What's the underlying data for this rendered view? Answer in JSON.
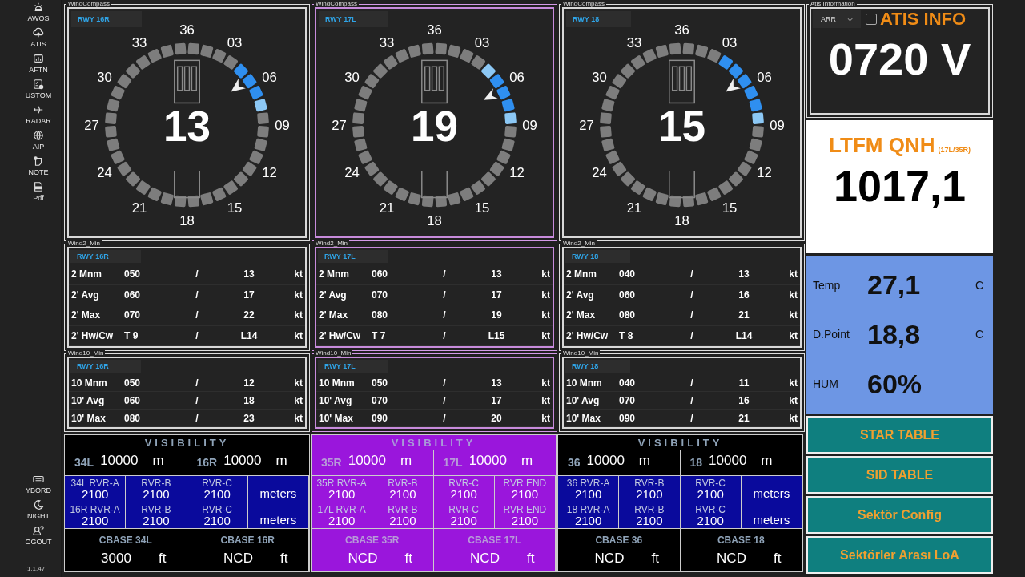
{
  "sidebar": {
    "top_items": [
      {
        "label": "AWOS"
      },
      {
        "label": "ATIS"
      },
      {
        "label": "AFTN"
      },
      {
        "label": "USTOM"
      },
      {
        "label": "RADAR"
      },
      {
        "label": "AIP"
      },
      {
        "label": "NOTE"
      },
      {
        "label": "Pdf"
      }
    ],
    "bottom_items": [
      {
        "label": "YBORD"
      },
      {
        "label": "NIGHT"
      },
      {
        "label": "OGOUT"
      }
    ],
    "version": "1.1.47"
  },
  "columns": [
    {
      "selected": false,
      "compass": {
        "legend": "WindCompass",
        "runway_tab": "RWY 16R",
        "runway_heading": "13",
        "dial_labels": [
          "36",
          "03",
          "06",
          "09",
          "12",
          "15",
          "18",
          "21",
          "24",
          "27",
          "30",
          "33"
        ],
        "segments": [
          {
            "kind": "off"
          },
          {
            "kind": "off"
          },
          {
            "kind": "off"
          },
          {
            "kind": "off"
          },
          {
            "kind": "main"
          },
          {
            "kind": "main"
          },
          {
            "kind": "main"
          },
          {
            "kind": "edge"
          },
          {
            "kind": "off"
          },
          {
            "kind": "off"
          },
          {
            "kind": "off"
          },
          {
            "kind": "off"
          },
          {
            "kind": "off"
          },
          {
            "kind": "off"
          },
          {
            "kind": "off"
          },
          {
            "kind": "off"
          },
          {
            "kind": "off"
          },
          {
            "kind": "off"
          },
          {
            "kind": "off"
          },
          {
            "kind": "off"
          },
          {
            "kind": "off"
          },
          {
            "kind": "off"
          },
          {
            "kind": "off"
          },
          {
            "kind": "off"
          },
          {
            "kind": "off"
          },
          {
            "kind": "off"
          },
          {
            "kind": "off"
          },
          {
            "kind": "off"
          },
          {
            "kind": "off"
          },
          {
            "kind": "off"
          },
          {
            "kind": "off"
          },
          {
            "kind": "off"
          },
          {
            "kind": "off"
          },
          {
            "kind": "off"
          },
          {
            "kind": "off"
          },
          {
            "kind": "off"
          }
        ]
      },
      "wind2": {
        "legend": "Wind2_Min",
        "runway_tab": "RWY 16R",
        "rows": [
          {
            "label": "2 Mnm",
            "direction": "050",
            "separator": "/",
            "speed": "13",
            "unit": "kt"
          },
          {
            "label": "2' Avg",
            "direction": "060",
            "separator": "/",
            "speed": "17",
            "unit": "kt"
          },
          {
            "label": "2' Max",
            "direction": "070",
            "separator": "/",
            "speed": "22",
            "unit": "kt"
          },
          {
            "label": "2' Hw/Cw",
            "direction": "T 9",
            "separator": "/",
            "speed": "L14",
            "unit": "kt"
          }
        ]
      },
      "wind10": {
        "legend": "Wind10_Min",
        "runway_tab": "RWY 16R",
        "rows": [
          {
            "label": "10 Mnm",
            "direction": "050",
            "separator": "/",
            "speed": "12",
            "unit": "kt"
          },
          {
            "label": "10' Avg",
            "direction": "060",
            "separator": "/",
            "speed": "18",
            "unit": "kt"
          },
          {
            "label": "10' Max",
            "direction": "080",
            "separator": "/",
            "speed": "23",
            "unit": "kt"
          }
        ]
      },
      "visibility": {
        "title": "VISIBILITY",
        "cells": [
          {
            "runway": "34L",
            "value": "10000",
            "unit": "m"
          },
          {
            "runway": "16R",
            "value": "10000",
            "unit": "m"
          }
        ],
        "rvr_rows": [
          [
            {
              "kind": "reading",
              "label": "34L  RVR-A",
              "value": "2100"
            },
            {
              "kind": "reading",
              "label": "RVR-B",
              "value": "2100"
            },
            {
              "kind": "reading",
              "label": "RVR-C",
              "value": "2100"
            },
            {
              "kind": "unit",
              "value": "meters"
            }
          ],
          [
            {
              "kind": "reading",
              "label": "16R  RVR-A",
              "value": "2100"
            },
            {
              "kind": "reading",
              "label": "RVR-B",
              "value": "2100"
            },
            {
              "kind": "reading",
              "label": "RVR-C",
              "value": "2100"
            },
            {
              "kind": "unit",
              "value": "meters"
            }
          ]
        ],
        "cbase": [
          {
            "label": "CBASE 34L",
            "value": "3000",
            "unit": "ft"
          },
          {
            "label": "CBASE 16R",
            "value": "NCD",
            "unit": "ft"
          }
        ]
      }
    },
    {
      "selected": true,
      "compass": {
        "legend": "WindCompass",
        "runway_tab": "RWY 17L",
        "runway_heading": "19",
        "dial_labels": [
          "36",
          "03",
          "06",
          "09",
          "12",
          "15",
          "18",
          "21",
          "24",
          "27",
          "30",
          "33"
        ],
        "segments": [
          {
            "kind": "off"
          },
          {
            "kind": "off"
          },
          {
            "kind": "off"
          },
          {
            "kind": "off"
          },
          {
            "kind": "edge"
          },
          {
            "kind": "main"
          },
          {
            "kind": "main"
          },
          {
            "kind": "main"
          },
          {
            "kind": "edge"
          },
          {
            "kind": "off"
          },
          {
            "kind": "off"
          },
          {
            "kind": "off"
          },
          {
            "kind": "off"
          },
          {
            "kind": "off"
          },
          {
            "kind": "off"
          },
          {
            "kind": "off"
          },
          {
            "kind": "off"
          },
          {
            "kind": "off"
          },
          {
            "kind": "off"
          },
          {
            "kind": "off"
          },
          {
            "kind": "off"
          },
          {
            "kind": "off"
          },
          {
            "kind": "off"
          },
          {
            "kind": "off"
          },
          {
            "kind": "off"
          },
          {
            "kind": "off"
          },
          {
            "kind": "off"
          },
          {
            "kind": "off"
          },
          {
            "kind": "off"
          },
          {
            "kind": "off"
          },
          {
            "kind": "off"
          },
          {
            "kind": "off"
          },
          {
            "kind": "off"
          },
          {
            "kind": "off"
          },
          {
            "kind": "off"
          },
          {
            "kind": "off"
          }
        ]
      },
      "wind2": {
        "legend": "Wind2_Min",
        "runway_tab": "RWY 17L",
        "rows": [
          {
            "label": "2 Mnm",
            "direction": "060",
            "separator": "/",
            "speed": "13",
            "unit": "kt"
          },
          {
            "label": "2' Avg",
            "direction": "070",
            "separator": "/",
            "speed": "17",
            "unit": "kt"
          },
          {
            "label": "2' Max",
            "direction": "080",
            "separator": "/",
            "speed": "19",
            "unit": "kt"
          },
          {
            "label": "2' Hw/Cw",
            "direction": "T 7",
            "separator": "/",
            "speed": "L15",
            "unit": "kt"
          }
        ]
      },
      "wind10": {
        "legend": "Wind10_Min",
        "runway_tab": "RWY 17L",
        "rows": [
          {
            "label": "10 Mnm",
            "direction": "050",
            "separator": "/",
            "speed": "13",
            "unit": "kt"
          },
          {
            "label": "10' Avg",
            "direction": "070",
            "separator": "/",
            "speed": "17",
            "unit": "kt"
          },
          {
            "label": "10' Max",
            "direction": "090",
            "separator": "/",
            "speed": "20",
            "unit": "kt"
          }
        ]
      },
      "visibility": {
        "title": "VISIBILITY",
        "cells": [
          {
            "runway": "35R",
            "value": "10000",
            "unit": "m"
          },
          {
            "runway": "17L",
            "value": "10000",
            "unit": "m"
          }
        ],
        "rvr_rows": [
          [
            {
              "kind": "reading",
              "label": "35R  RVR-A",
              "value": "2100"
            },
            {
              "kind": "reading",
              "label": "RVR-B",
              "value": "2100"
            },
            {
              "kind": "reading",
              "label": "RVR-C",
              "value": "2100"
            },
            {
              "kind": "reading",
              "label": "RVR END",
              "value": "2100"
            }
          ],
          [
            {
              "kind": "reading",
              "label": "17L  RVR-A",
              "value": "2100"
            },
            {
              "kind": "reading",
              "label": "RVR-B",
              "value": "2100"
            },
            {
              "kind": "reading",
              "label": "RVR-C",
              "value": "2100"
            },
            {
              "kind": "reading",
              "label": "RVR END",
              "value": "2100"
            }
          ]
        ],
        "cbase": [
          {
            "label": "CBASE 35R",
            "value": "NCD",
            "unit": "ft"
          },
          {
            "label": "CBASE 17L",
            "value": "NCD",
            "unit": "ft"
          }
        ]
      }
    },
    {
      "selected": false,
      "compass": {
        "legend": "WindCompass",
        "runway_tab": "RWY 18",
        "runway_heading": "15",
        "dial_labels": [
          "36",
          "03",
          "06",
          "09",
          "12",
          "15",
          "18",
          "21",
          "24",
          "27",
          "30",
          "33"
        ],
        "segments": [
          {
            "kind": "off"
          },
          {
            "kind": "off"
          },
          {
            "kind": "off"
          },
          {
            "kind": "main"
          },
          {
            "kind": "main"
          },
          {
            "kind": "main"
          },
          {
            "kind": "main"
          },
          {
            "kind": "main"
          },
          {
            "kind": "edge"
          },
          {
            "kind": "off"
          },
          {
            "kind": "off"
          },
          {
            "kind": "off"
          },
          {
            "kind": "off"
          },
          {
            "kind": "off"
          },
          {
            "kind": "off"
          },
          {
            "kind": "off"
          },
          {
            "kind": "off"
          },
          {
            "kind": "off"
          },
          {
            "kind": "off"
          },
          {
            "kind": "off"
          },
          {
            "kind": "off"
          },
          {
            "kind": "off"
          },
          {
            "kind": "off"
          },
          {
            "kind": "off"
          },
          {
            "kind": "off"
          },
          {
            "kind": "off"
          },
          {
            "kind": "off"
          },
          {
            "kind": "off"
          },
          {
            "kind": "off"
          },
          {
            "kind": "off"
          },
          {
            "kind": "off"
          },
          {
            "kind": "off"
          },
          {
            "kind": "off"
          },
          {
            "kind": "off"
          },
          {
            "kind": "off"
          },
          {
            "kind": "off"
          }
        ]
      },
      "wind2": {
        "legend": "Wind2_Min",
        "runway_tab": "RWY 18",
        "rows": [
          {
            "label": "2 Mnm",
            "direction": "040",
            "separator": "/",
            "speed": "13",
            "unit": "kt"
          },
          {
            "label": "2' Avg",
            "direction": "060",
            "separator": "/",
            "speed": "16",
            "unit": "kt"
          },
          {
            "label": "2' Max",
            "direction": "080",
            "separator": "/",
            "speed": "21",
            "unit": "kt"
          },
          {
            "label": "2' Hw/Cw",
            "direction": "T 8",
            "separator": "/",
            "speed": "L14",
            "unit": "kt"
          }
        ]
      },
      "wind10": {
        "legend": "Wind10_Min",
        "runway_tab": "RWY 18",
        "rows": [
          {
            "label": "10 Mnm",
            "direction": "040",
            "separator": "/",
            "speed": "11",
            "unit": "kt"
          },
          {
            "label": "10' Avg",
            "direction": "070",
            "separator": "/",
            "speed": "16",
            "unit": "kt"
          },
          {
            "label": "10' Max",
            "direction": "090",
            "separator": "/",
            "speed": "21",
            "unit": "kt"
          }
        ]
      },
      "visibility": {
        "title": "VISIBILITY",
        "cells": [
          {
            "runway": "36",
            "value": "10000",
            "unit": "m"
          },
          {
            "runway": "18",
            "value": "10000",
            "unit": "m"
          }
        ],
        "rvr_rows": [
          [
            {
              "kind": "reading",
              "label": "36 RVR-A",
              "value": "2100"
            },
            {
              "kind": "reading",
              "label": "RVR-B",
              "value": "2100"
            },
            {
              "kind": "reading",
              "label": "RVR-C",
              "value": "2100"
            },
            {
              "kind": "unit",
              "value": "meters"
            }
          ],
          [
            {
              "kind": "reading",
              "label": "18  RVR-A",
              "value": "2100"
            },
            {
              "kind": "reading",
              "label": "RVR-B",
              "value": "2100"
            },
            {
              "kind": "reading",
              "label": "RVR-C",
              "value": "2100"
            },
            {
              "kind": "unit",
              "value": "meters"
            }
          ]
        ],
        "cbase": [
          {
            "label": "CBASE 36",
            "value": "NCD",
            "unit": "ft"
          },
          {
            "label": "CBASE 18",
            "value": "NCD",
            "unit": "ft"
          }
        ]
      }
    }
  ],
  "atis": {
    "legend": "Atis Information",
    "mode": "ARR",
    "checked": false,
    "title": "ATIS INFO",
    "code": "0720 V"
  },
  "qnh": {
    "title": "LTFM QNH",
    "subtitle": "(17L/35R)",
    "value": "1017,1"
  },
  "weather": [
    {
      "label": "Temp",
      "value": "27,1",
      "unit": "C"
    },
    {
      "label": "D.Point",
      "value": "18,8",
      "unit": "C"
    },
    {
      "label": "HUM",
      "value": "60%"
    }
  ],
  "buttons": [
    "STAR TABLE",
    "SID TABLE",
    "Sektör Config",
    "Sektörler Arası LoA"
  ]
}
